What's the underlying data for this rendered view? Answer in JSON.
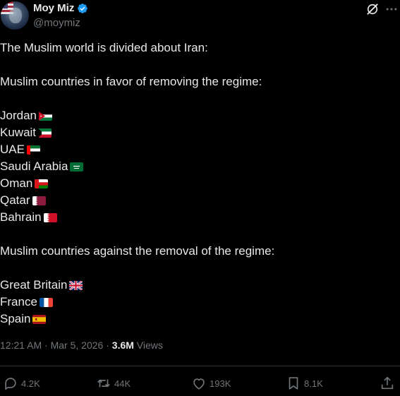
{
  "author": {
    "display_name": "Moy Miz",
    "handle": "@moymiz",
    "verified_icon": "verified-badge-icon",
    "verified_color": "#1d9bf0"
  },
  "header_icons": {
    "grok": "grok-icon",
    "more": "more-icon"
  },
  "tweet": {
    "intro": "The Muslim world is divided about Iran:",
    "favor_heading": "Muslim countries in favor of removing the regime:",
    "favor_countries": [
      {
        "name": "Jordan",
        "flag": "jordan-flag-icon"
      },
      {
        "name": "Kuwait",
        "flag": "kuwait-flag-icon"
      },
      {
        "name": "UAE",
        "flag": "uae-flag-icon"
      },
      {
        "name": "Saudi Arabia",
        "flag": "saudi-flag-icon"
      },
      {
        "name": "Oman",
        "flag": "oman-flag-icon"
      },
      {
        "name": "Qatar",
        "flag": "qatar-flag-icon"
      },
      {
        "name": "Bahrain",
        "flag": "bahrain-flag-icon"
      }
    ],
    "against_heading": "Muslim countries against the removal of the regime:",
    "against_countries": [
      {
        "name": "Great Britain",
        "flag": "uk-flag-icon"
      },
      {
        "name": "France",
        "flag": "france-flag-icon"
      },
      {
        "name": "Spain",
        "flag": "spain-flag-icon"
      }
    ]
  },
  "meta": {
    "time": "12:21 AM",
    "separator": "·",
    "date": "Mar 5, 2026",
    "separator2": "·",
    "views_count": "3.6M",
    "views_label": "Views"
  },
  "actions": {
    "replies": "4.2K",
    "reposts": "44K",
    "likes": "193K",
    "bookmarks": "8.1K"
  }
}
